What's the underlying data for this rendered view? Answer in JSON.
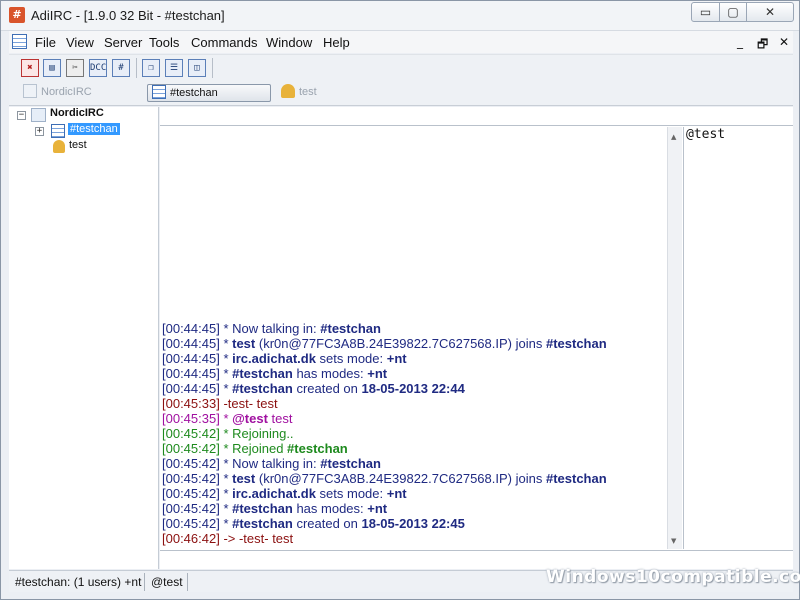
{
  "window": {
    "title": "AdiIRC - [1.9.0 32 Bit - #testchan]",
    "min_glyph": "▭",
    "max_glyph": "▢",
    "close_glyph": "✕"
  },
  "menu": {
    "items": [
      "File",
      "View",
      "Server",
      "Tools",
      "Commands",
      "Window",
      "Help"
    ],
    "mdi_min": "_",
    "mdi_restore": "🗗",
    "mdi_close": "✕"
  },
  "toolbar": {
    "dcc_label": "DCC",
    "hash_label": "#"
  },
  "switchbar": {
    "server": "NordicIRC",
    "channel": "#testchan",
    "query": "test"
  },
  "tree": {
    "server": "NordicIRC",
    "channel": "#testchan",
    "query": "test"
  },
  "messages": [
    {
      "ts": "[00:44:45]",
      "parts": [
        {
          "t": " * Now talking in: ",
          "s": "cnavy"
        },
        {
          "t": "#testchan",
          "s": "cnavy b"
        }
      ]
    },
    {
      "ts": "[00:44:45]",
      "parts": [
        {
          "t": " * ",
          "s": "cnavy"
        },
        {
          "t": "test",
          "s": "cnavy b"
        },
        {
          "t": " (kr0n@77FC3A8B.24E39822.7C627568.IP) joins ",
          "s": "cnavy"
        },
        {
          "t": "#testchan",
          "s": "cnavy b"
        }
      ]
    },
    {
      "ts": "[00:44:45]",
      "parts": [
        {
          "t": " * ",
          "s": "cnavy"
        },
        {
          "t": "irc.adichat.dk",
          "s": "cnavy b"
        },
        {
          "t": " sets mode: ",
          "s": "cnavy"
        },
        {
          "t": "+nt",
          "s": "cnavy b"
        }
      ]
    },
    {
      "ts": "[00:44:45]",
      "parts": [
        {
          "t": " * ",
          "s": "cnavy"
        },
        {
          "t": "#testchan",
          "s": "cnavy b"
        },
        {
          "t": " has modes: ",
          "s": "cnavy"
        },
        {
          "t": "+nt",
          "s": "cnavy b"
        }
      ]
    },
    {
      "ts": "[00:44:45]",
      "parts": [
        {
          "t": " * ",
          "s": "cnavy"
        },
        {
          "t": "#testchan",
          "s": "cnavy b"
        },
        {
          "t": " created on ",
          "s": "cnavy"
        },
        {
          "t": "18-05-2013 22:44",
          "s": "cnavy b"
        }
      ]
    },
    {
      "ts": "[00:45:33]",
      "tsc": "cred",
      "parts": [
        {
          "t": " -test- test",
          "s": "cred"
        }
      ]
    },
    {
      "ts": "[00:45:35]",
      "tsc": "cmag",
      "parts": [
        {
          "t": " * ",
          "s": "cmag"
        },
        {
          "t": "@test",
          "s": "cmag b"
        },
        {
          "t": " test",
          "s": "cmag"
        }
      ]
    },
    {
      "ts": "[00:45:42]",
      "tsc": "cgrn",
      "parts": [
        {
          "t": " * Rejoining..",
          "s": "cgrn"
        }
      ]
    },
    {
      "ts": "[00:45:42]",
      "tsc": "cgrn",
      "parts": [
        {
          "t": " * Rejoined ",
          "s": "cgrn"
        },
        {
          "t": "#testchan",
          "s": "cgrn b"
        }
      ]
    },
    {
      "ts": "[00:45:42]",
      "parts": [
        {
          "t": " * Now talking in: ",
          "s": "cnavy"
        },
        {
          "t": "#testchan",
          "s": "cnavy b"
        }
      ]
    },
    {
      "ts": "[00:45:42]",
      "parts": [
        {
          "t": " * ",
          "s": "cnavy"
        },
        {
          "t": "test",
          "s": "cnavy b"
        },
        {
          "t": " (kr0n@77FC3A8B.24E39822.7C627568.IP) joins ",
          "s": "cnavy"
        },
        {
          "t": "#testchan",
          "s": "cnavy b"
        }
      ]
    },
    {
      "ts": "[00:45:42]",
      "parts": [
        {
          "t": " * ",
          "s": "cnavy"
        },
        {
          "t": "irc.adichat.dk",
          "s": "cnavy b"
        },
        {
          "t": " sets mode: ",
          "s": "cnavy"
        },
        {
          "t": "+nt",
          "s": "cnavy b"
        }
      ]
    },
    {
      "ts": "[00:45:42]",
      "parts": [
        {
          "t": " * ",
          "s": "cnavy"
        },
        {
          "t": "#testchan",
          "s": "cnavy b"
        },
        {
          "t": " has modes: ",
          "s": "cnavy"
        },
        {
          "t": "+nt",
          "s": "cnavy b"
        }
      ]
    },
    {
      "ts": "[00:45:42]",
      "parts": [
        {
          "t": " * ",
          "s": "cnavy"
        },
        {
          "t": "#testchan",
          "s": "cnavy b"
        },
        {
          "t": " created on ",
          "s": "cnavy"
        },
        {
          "t": "18-05-2013 22:45",
          "s": "cnavy b"
        }
      ]
    },
    {
      "ts": "[00:46:42]",
      "tsc": "cred",
      "parts": [
        {
          "t": " -> -test- test",
          "s": "cred"
        }
      ]
    }
  ],
  "nicklist": [
    "@test"
  ],
  "statusbar": {
    "channel_info": "#testchan: (1 users) +nt",
    "nick": "@test"
  },
  "watermark": "Windows10compatible.com",
  "colors": {
    "timestamp": "#1f2a82",
    "notice": "#8b1010",
    "action": "#a010a0",
    "rejoin": "#1e8a1e"
  }
}
